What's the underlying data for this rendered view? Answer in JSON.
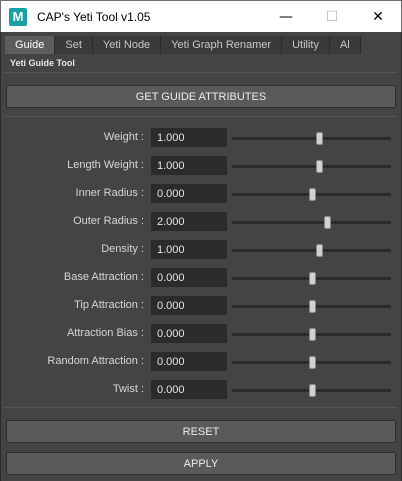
{
  "window": {
    "title": "CAP's Yeti Tool v1.05",
    "icon_letter": "M",
    "minimize": "—",
    "maximize": "☐",
    "close": "✕"
  },
  "tabs": [
    "Guide",
    "Set",
    "Yeti Node",
    "Yeti Graph Renamer",
    "Utility",
    "Al"
  ],
  "active_tab": "Guide",
  "section_title": "Yeti Guide Tool",
  "get_button": "GET GUIDE ATTRIBUTES",
  "attributes": [
    {
      "label": "Weight :",
      "value": "1.000",
      "slider": 0.55
    },
    {
      "label": "Length Weight :",
      "value": "1.000",
      "slider": 0.55
    },
    {
      "label": "Inner Radius :",
      "value": "0.000",
      "slider": 0.5
    },
    {
      "label": "Outer Radius :",
      "value": "2.000",
      "slider": 0.6
    },
    {
      "label": "Density :",
      "value": "1.000",
      "slider": 0.55
    },
    {
      "label": "Base Attraction :",
      "value": "0.000",
      "slider": 0.5
    },
    {
      "label": "Tip Attraction :",
      "value": "0.000",
      "slider": 0.5
    },
    {
      "label": "Attraction Bias :",
      "value": "0.000",
      "slider": 0.5
    },
    {
      "label": "Random Attraction :",
      "value": "0.000",
      "slider": 0.5
    },
    {
      "label": "Twist :",
      "value": "0.000",
      "slider": 0.5
    }
  ],
  "reset_button": "RESET",
  "apply_button": "APPLY"
}
